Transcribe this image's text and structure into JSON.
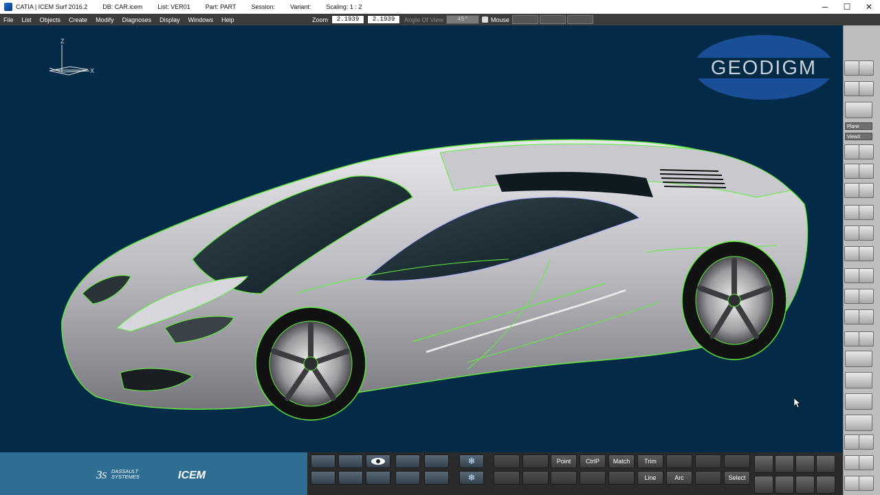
{
  "titlebar": {
    "app_title": "CATIA | ICEM Surf 2016.2",
    "db": "DB: CAR.icem",
    "list": "List: VER01",
    "part": "Part: PART",
    "session": "Session:",
    "variant": "Variant:",
    "scaling": "Scaling: 1 : 2",
    "minimize": "─",
    "maximize": "☐",
    "close": "✕"
  },
  "menu": {
    "items": [
      "File",
      "List",
      "Objects",
      "Create",
      "Modify",
      "Diagnoses",
      "Display",
      "Windows",
      "Help"
    ]
  },
  "zoom_bar": {
    "zoom_label": "Zoom",
    "zoom_value_1": "2.1939",
    "zoom_value_2": "2.1939",
    "angle_label": "Angle Of View",
    "angle_value": "45°",
    "mouse_label": "Mouse"
  },
  "viewport": {
    "logo_text": "GEODIGM",
    "axis_z": "Z",
    "axis_x": "X"
  },
  "right_toolbar": {
    "select_1": "Plane",
    "select_2": "View3"
  },
  "brand": {
    "dassault_line1": "DASSAULT",
    "dassault_line2": "SYSTEMES",
    "icem": "ICEM"
  },
  "bottom_toolbar": {
    "btn_point": "Point",
    "btn_ctrlp": "CtrlP",
    "btn_match": "Match",
    "btn_trim": "Trim",
    "btn_line": "Line",
    "btn_arc": "Arc",
    "btn_select": "Select"
  },
  "colors": {
    "viewport_bg": "#032a47",
    "highlight_green": "#5ef03a",
    "brand_panel": "#2f6e93",
    "logo_blue": "#1a4f98"
  }
}
